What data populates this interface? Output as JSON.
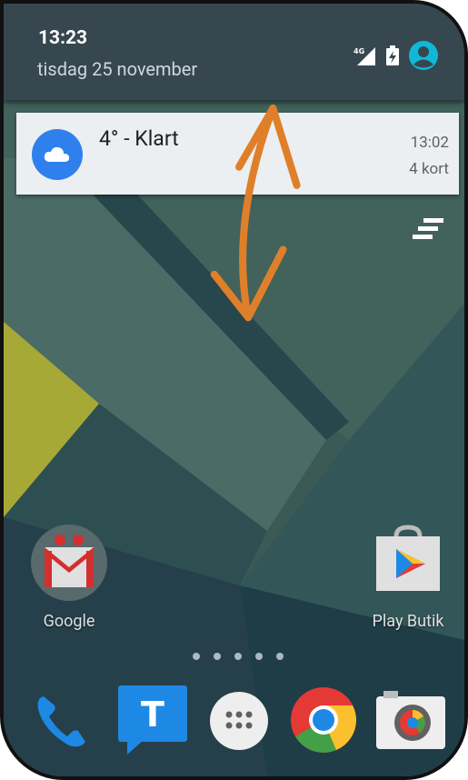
{
  "status_bar": {
    "time": "13:23",
    "date": "tisdag 25 november",
    "icons": [
      "4g-signal-icon",
      "battery-charging-icon",
      "account-icon"
    ],
    "network_label": "4G"
  },
  "notification": {
    "title": "4° - Klart",
    "time": "13:02",
    "count": "4 kort",
    "icon": "cloud-icon",
    "accent": "#2f80ed"
  },
  "home": {
    "apps": [
      {
        "label": "Google",
        "icon": "gmail-icon"
      },
      {
        "label": "Play Butik",
        "icon": "play-store-icon"
      }
    ],
    "page_dots": 5,
    "dock": [
      {
        "icon": "phone-icon"
      },
      {
        "icon": "messaging-icon",
        "letter": "T"
      },
      {
        "icon": "app-drawer-icon"
      },
      {
        "icon": "chrome-icon"
      },
      {
        "icon": "camera-icon"
      }
    ]
  },
  "annotation": {
    "type": "double-arrow",
    "color": "#e07f2a"
  }
}
